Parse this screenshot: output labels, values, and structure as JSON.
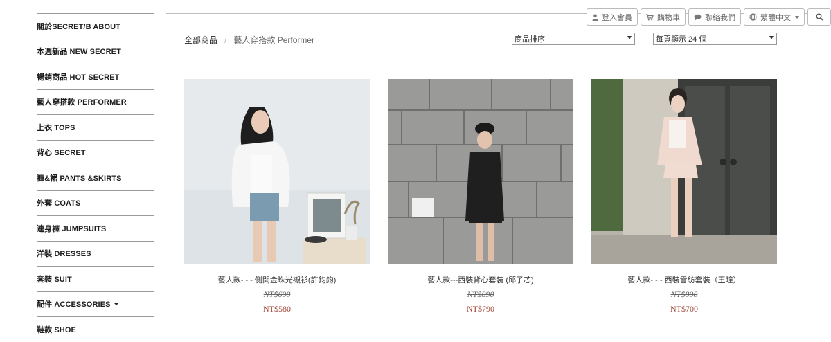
{
  "sidebar": {
    "items": [
      {
        "label": "關於SECRET/B ABOUT"
      },
      {
        "label": "本週新品 NEW SECRET"
      },
      {
        "label": "暢銷商品 HOT SECRET"
      },
      {
        "label": "藝人穿搭款 PERFORMER"
      },
      {
        "label": "上衣 TOPS"
      },
      {
        "label": "背心 SECRET"
      },
      {
        "label": "褲&裙 PANTS &SKIRTS"
      },
      {
        "label": "外套 COATS"
      },
      {
        "label": "連身褲 JUMPSUITS"
      },
      {
        "label": "洋裝 DRESSES"
      },
      {
        "label": "套裝 SUIT"
      },
      {
        "label": "配件 ACCESSORIES"
      },
      {
        "label": "鞋款 SHOE"
      }
    ]
  },
  "toolbar": {
    "login_label": "登入會員",
    "cart_label": "購物車",
    "contact_label": "聯絡我們",
    "language_label": "繁體中文"
  },
  "breadcrumb": {
    "root": "全部商品",
    "separator": "/",
    "current": "藝人穿搭款 Performer"
  },
  "sort": {
    "selected": "商品排序"
  },
  "per_page": {
    "selected": "每頁顯示 24 個"
  },
  "products": [
    {
      "name": "藝人款- - - 側開金珠光襯衫(許鈞鈞)",
      "original_price": "NT$690",
      "sale_price": "NT$580"
    },
    {
      "name": "藝人款---西裝背心套裝 (邱子芯)",
      "original_price": "NT$890",
      "sale_price": "NT$790"
    },
    {
      "name": "藝人款- - - 西裝雪紡套裝（王瞳）",
      "original_price": "NT$890",
      "sale_price": "NT$700"
    }
  ],
  "colors": {
    "sale_price": "#a0473a",
    "border": "#9a9a9a"
  }
}
